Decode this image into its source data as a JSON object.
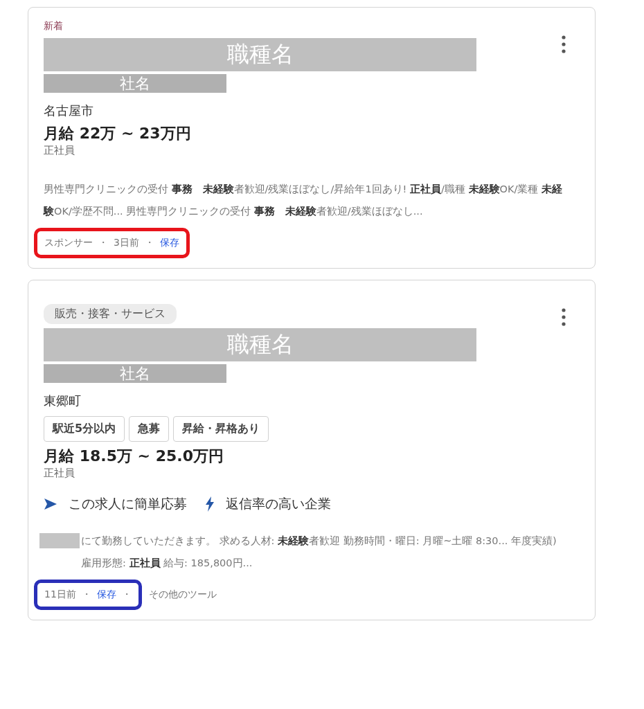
{
  "cards": [
    {
      "label": {
        "kind": "new",
        "text": "新着"
      },
      "title_redaction": "職種名",
      "company_redaction": "社名",
      "location": "名古屋市",
      "salary": "月給 22万 ~ 23万円",
      "employment_type": "正社員",
      "snippet_redaction": false,
      "snippet": "男性専門クリニックの受付 **事務**　**未経験**者歓迎/残業ほぼなし/昇給年1回あり! **正社員**/職種 **未経験**OK/業種 **未経験**OK/学歴不問... 男性専門クリニックの受付 **事務**　**未経験**者歓迎/残業ほぼなし...",
      "annotation": {
        "color": "#e8141b"
      },
      "footer_highlighted": [
        {
          "kind": "text",
          "text": "スポンサー"
        },
        {
          "kind": "separator",
          "text": "・"
        },
        {
          "kind": "text",
          "text": "3日前"
        },
        {
          "kind": "separator",
          "text": "・"
        },
        {
          "kind": "link",
          "text": "保存"
        }
      ]
    },
    {
      "label": {
        "kind": "category",
        "text": "販売・接客・サービス"
      },
      "title_redaction": "職種名",
      "company_redaction": "社名",
      "location": "東郷町",
      "tags": [
        "駅近5分以内",
        "急募",
        "昇給・昇格あり"
      ],
      "salary": "月給 18.5万 ~ 25.0万円",
      "employment_type": "正社員",
      "features": [
        {
          "kind": "send",
          "text": "この求人に簡単応募"
        },
        {
          "kind": "bolt",
          "text": "返信率の高い企業"
        }
      ],
      "snippet_redaction": true,
      "snippet": "にて勤務していただきます。 求める人材: **未経験**者歓迎 勤務時間・曜日: 月曜~土曜 8:30... 年度実績) 雇用形態: **正社員** 給与: 185,800円...",
      "annotation": {
        "color": "#2a2fb8"
      },
      "footer_highlighted": [
        {
          "kind": "text",
          "text": "11日前"
        },
        {
          "kind": "separator",
          "text": "・"
        },
        {
          "kind": "link",
          "text": "保存"
        },
        {
          "kind": "separator",
          "text": "・"
        }
      ],
      "footer_other": [
        {
          "kind": "text",
          "text": "その他のツール"
        }
      ]
    }
  ]
}
